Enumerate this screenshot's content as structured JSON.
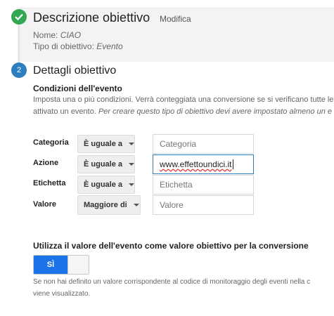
{
  "step1": {
    "title": "Descrizione obiettivo",
    "edit_label": "Modifica",
    "name_label": "Nome:",
    "name_value": "CIAO",
    "type_label": "Tipo di obiettivo:",
    "type_value": "Evento"
  },
  "step2": {
    "number": "2",
    "title": "Dettagli obiettivo",
    "conditions_title": "Condizioni dell'evento",
    "desc_line1": "Imposta una o più condizioni. Verrà conteggiata una conversione se si verificano tutte le",
    "desc_line2_plain": "attivato un evento.",
    "desc_line2_italic": "Per creare questo tipo di obiettivo devi avere impostato almeno un e"
  },
  "conditions": [
    {
      "label": "Categoria",
      "operator": "È uguale a",
      "value": "",
      "placeholder": "Categoria"
    },
    {
      "label": "Azione",
      "operator": "È uguale a",
      "value": "www.effettoundici.it",
      "placeholder": ""
    },
    {
      "label": "Etichetta",
      "operator": "È uguale a",
      "value": "",
      "placeholder": "Etichetta"
    },
    {
      "label": "Valore",
      "operator": "Maggiore di",
      "value": "",
      "placeholder": "Valore"
    }
  ],
  "conversion": {
    "title": "Utilizza il valore dell'evento come valore obiettivo per la conversione",
    "toggle_label": "SÌ",
    "toggle_on": true,
    "help_line1": "Se non hai definito un valore corrispondente al codice di monitoraggio degli eventi nella c",
    "help_line2": "viene visualizzato."
  },
  "colors": {
    "check_green": "#33a853",
    "step_blue": "#2d7fc0",
    "toggle_blue": "#1a73e8"
  },
  "icons": {
    "step1": "check-icon",
    "dropdown": "caret-down-icon"
  }
}
